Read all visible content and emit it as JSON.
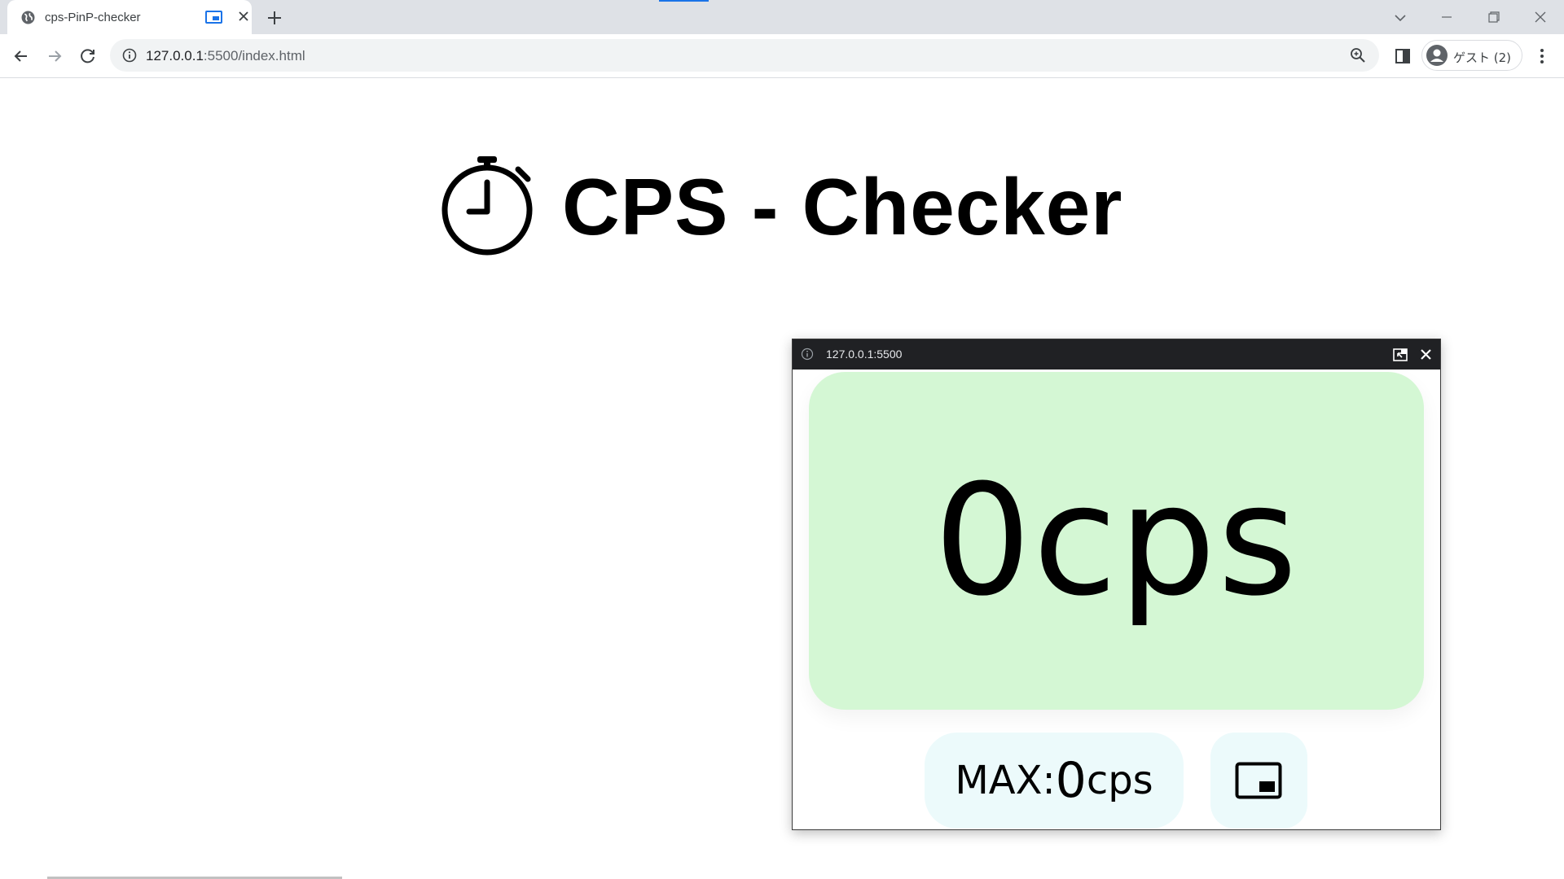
{
  "browser": {
    "tab": {
      "title": "cps-PinP-checker"
    },
    "omnibox": {
      "url_host": "127.0.0.1",
      "url_rest": ":5500/index.html"
    },
    "profile": {
      "label": "ゲスト (2)"
    }
  },
  "page": {
    "heading": "CPS - Checker",
    "icon": "stopwatch-icon"
  },
  "pip": {
    "title_url": "127.0.0.1:5500",
    "cps": {
      "value": "0",
      "unit": "cps"
    },
    "max": {
      "label": "MAX:",
      "value": "0",
      "unit": "cps"
    },
    "button_icon": "picture-in-picture-icon",
    "colors": {
      "card": "#d4f7d4",
      "box": "#ecfafb",
      "titlebar": "#202124"
    }
  },
  "colors": {
    "accent": "#1a73e8",
    "tabstrip": "#dee1e6"
  }
}
